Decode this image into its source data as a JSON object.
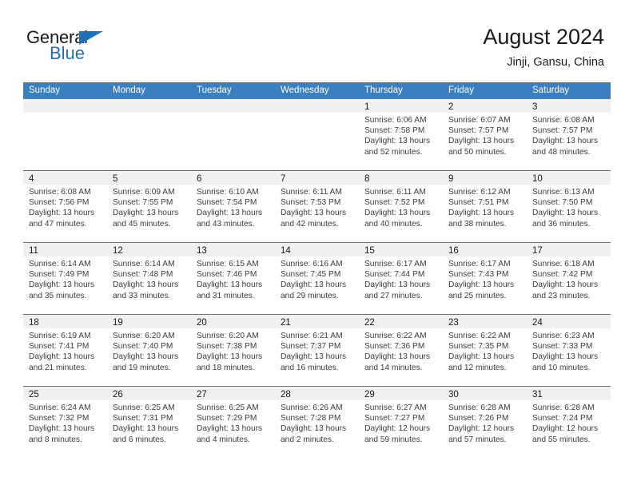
{
  "brand": {
    "word1": "General",
    "word2": "Blue",
    "flag_color": "#1e70b8"
  },
  "header": {
    "title": "August 2024",
    "subtitle": "Jinji, Gansu, China",
    "accent_color": "#3a7fc1",
    "daynum_band_color": "#f0f0f0"
  },
  "weekdays": [
    "Sunday",
    "Monday",
    "Tuesday",
    "Wednesday",
    "Thursday",
    "Friday",
    "Saturday"
  ],
  "weeks": [
    [
      {
        "day": "",
        "sunrise": "",
        "sunset": "",
        "daylight1": "",
        "daylight2": ""
      },
      {
        "day": "",
        "sunrise": "",
        "sunset": "",
        "daylight1": "",
        "daylight2": ""
      },
      {
        "day": "",
        "sunrise": "",
        "sunset": "",
        "daylight1": "",
        "daylight2": ""
      },
      {
        "day": "",
        "sunrise": "",
        "sunset": "",
        "daylight1": "",
        "daylight2": ""
      },
      {
        "day": "1",
        "sunrise": "Sunrise: 6:06 AM",
        "sunset": "Sunset: 7:58 PM",
        "daylight1": "Daylight: 13 hours",
        "daylight2": "and 52 minutes."
      },
      {
        "day": "2",
        "sunrise": "Sunrise: 6:07 AM",
        "sunset": "Sunset: 7:57 PM",
        "daylight1": "Daylight: 13 hours",
        "daylight2": "and 50 minutes."
      },
      {
        "day": "3",
        "sunrise": "Sunrise: 6:08 AM",
        "sunset": "Sunset: 7:57 PM",
        "daylight1": "Daylight: 13 hours",
        "daylight2": "and 48 minutes."
      }
    ],
    [
      {
        "day": "4",
        "sunrise": "Sunrise: 6:08 AM",
        "sunset": "Sunset: 7:56 PM",
        "daylight1": "Daylight: 13 hours",
        "daylight2": "and 47 minutes."
      },
      {
        "day": "5",
        "sunrise": "Sunrise: 6:09 AM",
        "sunset": "Sunset: 7:55 PM",
        "daylight1": "Daylight: 13 hours",
        "daylight2": "and 45 minutes."
      },
      {
        "day": "6",
        "sunrise": "Sunrise: 6:10 AM",
        "sunset": "Sunset: 7:54 PM",
        "daylight1": "Daylight: 13 hours",
        "daylight2": "and 43 minutes."
      },
      {
        "day": "7",
        "sunrise": "Sunrise: 6:11 AM",
        "sunset": "Sunset: 7:53 PM",
        "daylight1": "Daylight: 13 hours",
        "daylight2": "and 42 minutes."
      },
      {
        "day": "8",
        "sunrise": "Sunrise: 6:11 AM",
        "sunset": "Sunset: 7:52 PM",
        "daylight1": "Daylight: 13 hours",
        "daylight2": "and 40 minutes."
      },
      {
        "day": "9",
        "sunrise": "Sunrise: 6:12 AM",
        "sunset": "Sunset: 7:51 PM",
        "daylight1": "Daylight: 13 hours",
        "daylight2": "and 38 minutes."
      },
      {
        "day": "10",
        "sunrise": "Sunrise: 6:13 AM",
        "sunset": "Sunset: 7:50 PM",
        "daylight1": "Daylight: 13 hours",
        "daylight2": "and 36 minutes."
      }
    ],
    [
      {
        "day": "11",
        "sunrise": "Sunrise: 6:14 AM",
        "sunset": "Sunset: 7:49 PM",
        "daylight1": "Daylight: 13 hours",
        "daylight2": "and 35 minutes."
      },
      {
        "day": "12",
        "sunrise": "Sunrise: 6:14 AM",
        "sunset": "Sunset: 7:48 PM",
        "daylight1": "Daylight: 13 hours",
        "daylight2": "and 33 minutes."
      },
      {
        "day": "13",
        "sunrise": "Sunrise: 6:15 AM",
        "sunset": "Sunset: 7:46 PM",
        "daylight1": "Daylight: 13 hours",
        "daylight2": "and 31 minutes."
      },
      {
        "day": "14",
        "sunrise": "Sunrise: 6:16 AM",
        "sunset": "Sunset: 7:45 PM",
        "daylight1": "Daylight: 13 hours",
        "daylight2": "and 29 minutes."
      },
      {
        "day": "15",
        "sunrise": "Sunrise: 6:17 AM",
        "sunset": "Sunset: 7:44 PM",
        "daylight1": "Daylight: 13 hours",
        "daylight2": "and 27 minutes."
      },
      {
        "day": "16",
        "sunrise": "Sunrise: 6:17 AM",
        "sunset": "Sunset: 7:43 PM",
        "daylight1": "Daylight: 13 hours",
        "daylight2": "and 25 minutes."
      },
      {
        "day": "17",
        "sunrise": "Sunrise: 6:18 AM",
        "sunset": "Sunset: 7:42 PM",
        "daylight1": "Daylight: 13 hours",
        "daylight2": "and 23 minutes."
      }
    ],
    [
      {
        "day": "18",
        "sunrise": "Sunrise: 6:19 AM",
        "sunset": "Sunset: 7:41 PM",
        "daylight1": "Daylight: 13 hours",
        "daylight2": "and 21 minutes."
      },
      {
        "day": "19",
        "sunrise": "Sunrise: 6:20 AM",
        "sunset": "Sunset: 7:40 PM",
        "daylight1": "Daylight: 13 hours",
        "daylight2": "and 19 minutes."
      },
      {
        "day": "20",
        "sunrise": "Sunrise: 6:20 AM",
        "sunset": "Sunset: 7:38 PM",
        "daylight1": "Daylight: 13 hours",
        "daylight2": "and 18 minutes."
      },
      {
        "day": "21",
        "sunrise": "Sunrise: 6:21 AM",
        "sunset": "Sunset: 7:37 PM",
        "daylight1": "Daylight: 13 hours",
        "daylight2": "and 16 minutes."
      },
      {
        "day": "22",
        "sunrise": "Sunrise: 6:22 AM",
        "sunset": "Sunset: 7:36 PM",
        "daylight1": "Daylight: 13 hours",
        "daylight2": "and 14 minutes."
      },
      {
        "day": "23",
        "sunrise": "Sunrise: 6:22 AM",
        "sunset": "Sunset: 7:35 PM",
        "daylight1": "Daylight: 13 hours",
        "daylight2": "and 12 minutes."
      },
      {
        "day": "24",
        "sunrise": "Sunrise: 6:23 AM",
        "sunset": "Sunset: 7:33 PM",
        "daylight1": "Daylight: 13 hours",
        "daylight2": "and 10 minutes."
      }
    ],
    [
      {
        "day": "25",
        "sunrise": "Sunrise: 6:24 AM",
        "sunset": "Sunset: 7:32 PM",
        "daylight1": "Daylight: 13 hours",
        "daylight2": "and 8 minutes."
      },
      {
        "day": "26",
        "sunrise": "Sunrise: 6:25 AM",
        "sunset": "Sunset: 7:31 PM",
        "daylight1": "Daylight: 13 hours",
        "daylight2": "and 6 minutes."
      },
      {
        "day": "27",
        "sunrise": "Sunrise: 6:25 AM",
        "sunset": "Sunset: 7:29 PM",
        "daylight1": "Daylight: 13 hours",
        "daylight2": "and 4 minutes."
      },
      {
        "day": "28",
        "sunrise": "Sunrise: 6:26 AM",
        "sunset": "Sunset: 7:28 PM",
        "daylight1": "Daylight: 13 hours",
        "daylight2": "and 2 minutes."
      },
      {
        "day": "29",
        "sunrise": "Sunrise: 6:27 AM",
        "sunset": "Sunset: 7:27 PM",
        "daylight1": "Daylight: 12 hours",
        "daylight2": "and 59 minutes."
      },
      {
        "day": "30",
        "sunrise": "Sunrise: 6:28 AM",
        "sunset": "Sunset: 7:26 PM",
        "daylight1": "Daylight: 12 hours",
        "daylight2": "and 57 minutes."
      },
      {
        "day": "31",
        "sunrise": "Sunrise: 6:28 AM",
        "sunset": "Sunset: 7:24 PM",
        "daylight1": "Daylight: 12 hours",
        "daylight2": "and 55 minutes."
      }
    ]
  ]
}
